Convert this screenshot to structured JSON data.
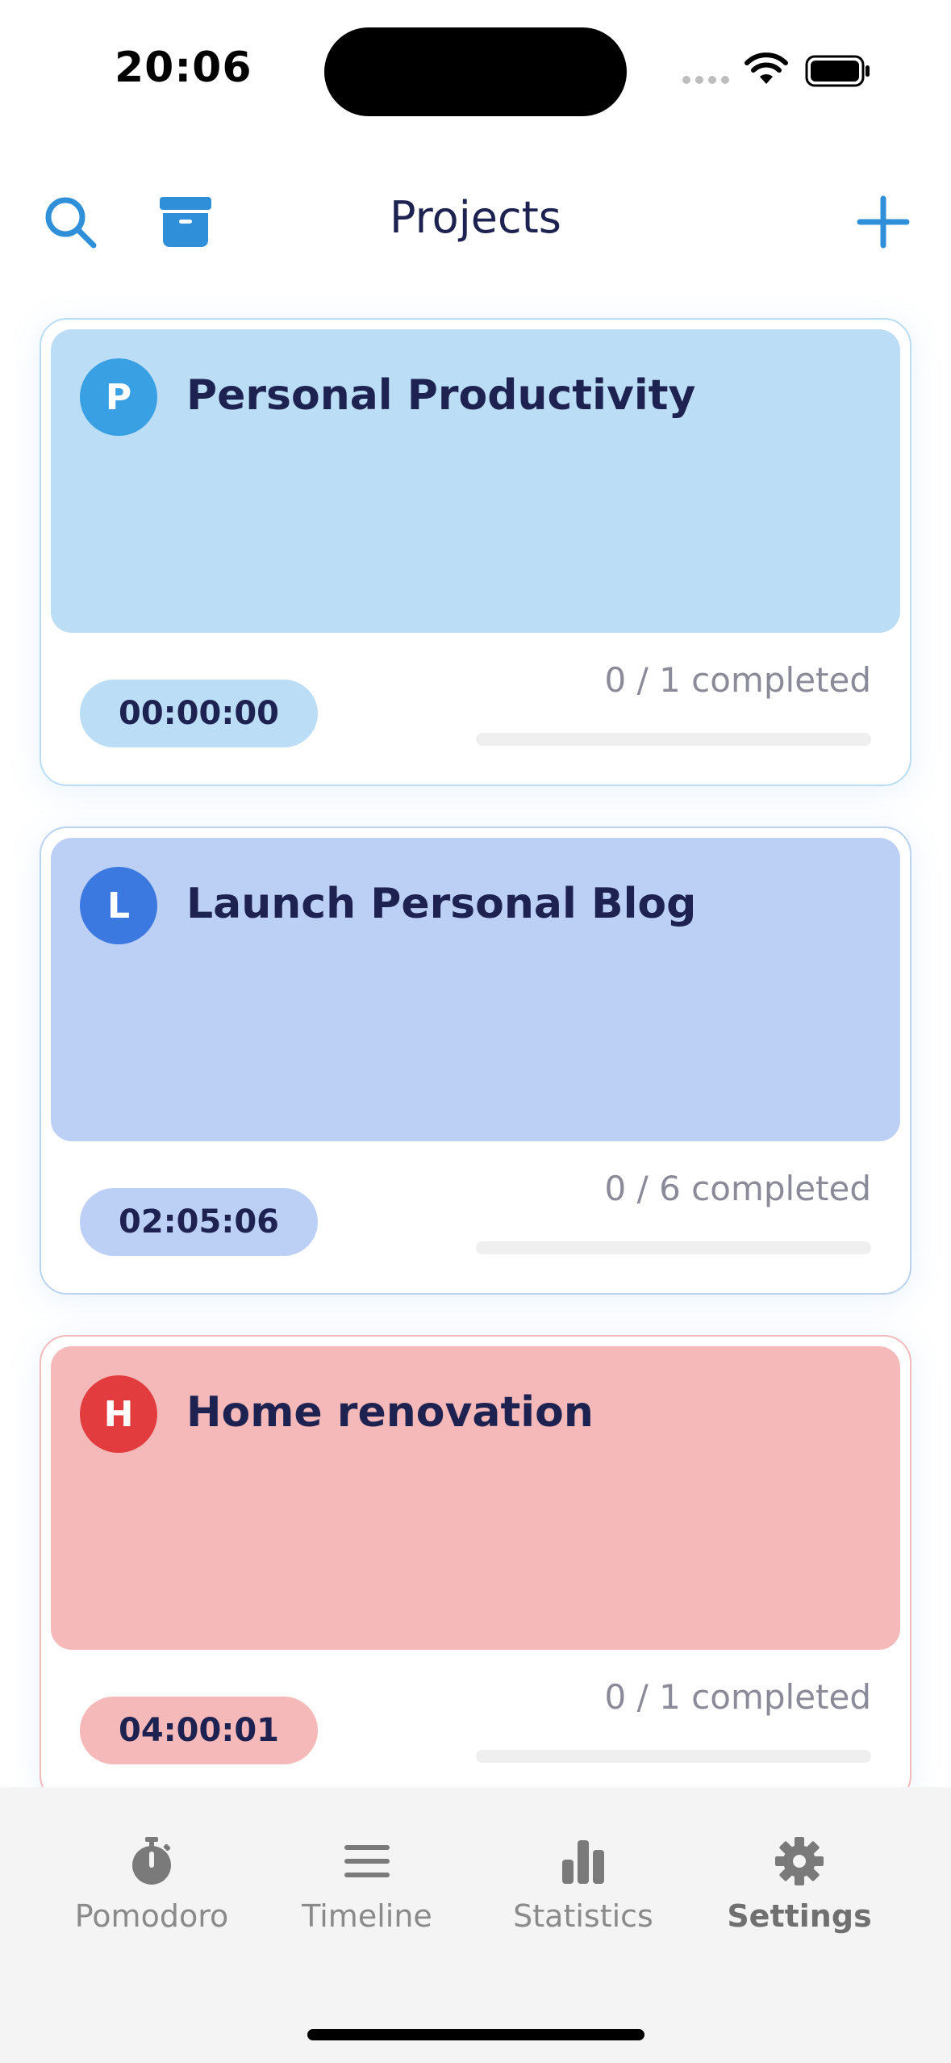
{
  "status_bar": {
    "time": "20:06"
  },
  "header": {
    "title": "Projects"
  },
  "projects": [
    {
      "initial": "P",
      "name": "Personal Productivity",
      "timer": "00:00:00",
      "progress_text": "0 / 1 completed",
      "progress": 0.0,
      "color_bg": "#bbdef6",
      "color_avatar": "#3aa0e4",
      "color_border": "#b9ddf4"
    },
    {
      "initial": "L",
      "name": "Launch Personal Blog",
      "timer": "02:05:06",
      "progress_text": "0 / 6 completed",
      "progress": 0.0,
      "color_bg": "#bccff5",
      "color_avatar": "#3b78e0",
      "color_border": "#b9d3f0"
    },
    {
      "initial": "H",
      "name": "Home renovation",
      "timer": "04:00:01",
      "progress_text": "0 / 1 completed",
      "progress": 0.0,
      "color_bg": "#f5b9ba",
      "color_avatar": "#e23c3e",
      "color_border": "#f3b9bb"
    }
  ],
  "tabs": [
    {
      "label": "Pomodoro",
      "icon": "stopwatch-icon"
    },
    {
      "label": "Timeline",
      "icon": "list-icon"
    },
    {
      "label": "Statistics",
      "icon": "bar-chart-icon"
    },
    {
      "label": "Settings",
      "icon": "gear-icon",
      "active": true
    }
  ],
  "colors": {
    "accent": "#2f8fd8",
    "title": "#1e2250",
    "tab_icon": "#7a7a7a"
  }
}
